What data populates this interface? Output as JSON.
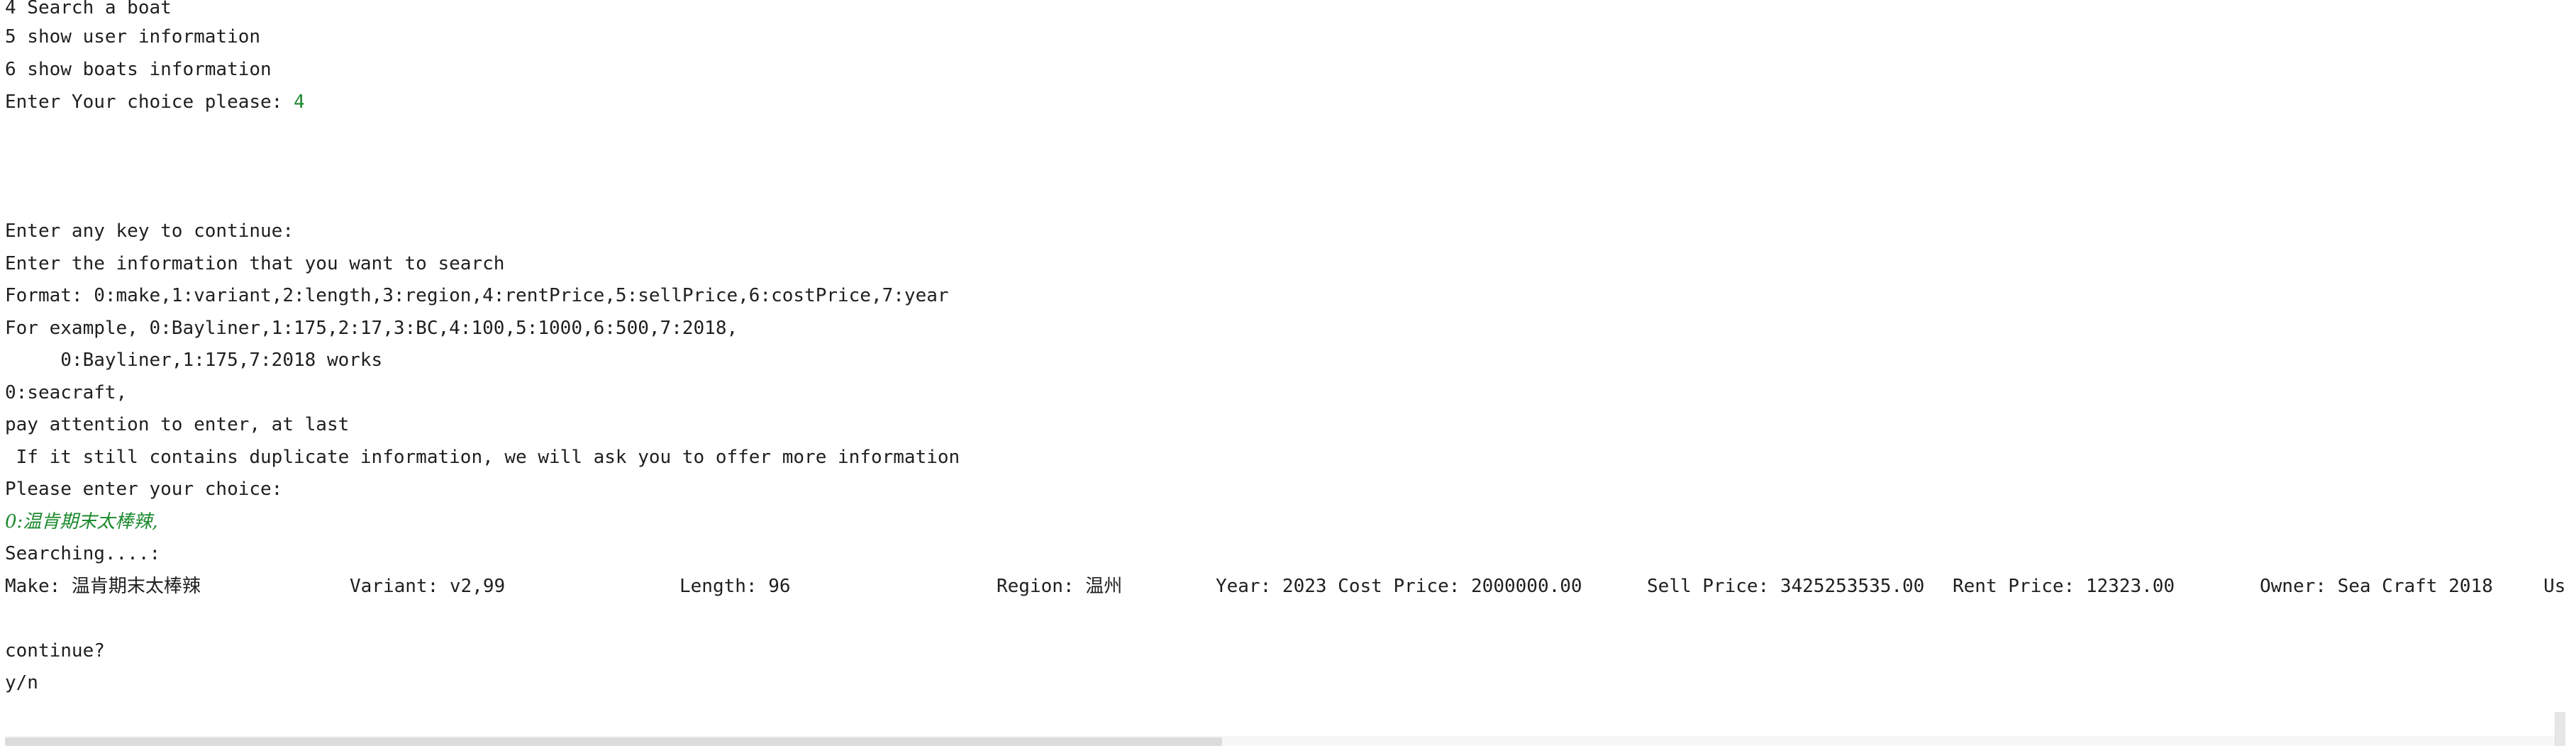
{
  "console": {
    "menu": [
      "4 Search a boat",
      "5 show user information",
      "6 show boats information"
    ],
    "choice_prompt": "Enter Your choice please: ",
    "choice_value": "4",
    "continue_prompt": "Enter any key to continue:",
    "search_intro": "Enter the information that you want to search",
    "format_line": "Format: 0:make,1:variant,2:length,3:region,4:rentPrice,5:sellPrice,6:costPrice,7:year",
    "example_line_1": "For example, 0:Bayliner,1:175,2:17,3:BC,4:100,5:1000,6:500,7:2018,",
    "example_line_2": "     0:Bayliner,1:175,7:2018 works",
    "echo_line": "0:seacraft,",
    "attention_line": "pay attention to enter, at last",
    "duplicate_line": " If it still contains duplicate information, we will ask you to offer more information",
    "enter_choice_prompt": "Please enter your choice:",
    "user_input": "0:温肯期末太棒辣,",
    "searching": "Searching....:",
    "result": {
      "make_label": "Make: ",
      "make_value": "温肯期末太棒辣",
      "variant": "Variant: v2,99",
      "length": "Length: 96",
      "region_label": "Region: ",
      "region_value": "温州",
      "year_cost": "Year: 2023 Cost Price: 2000000.00",
      "sell": "Sell Price: 3425253535.00",
      "rent": "Rent Price: 12323.00",
      "owner": "Owner: Sea Craft 2018",
      "overflow": "Us"
    },
    "continue_question": "continue?",
    "yn": "y/n"
  },
  "colors": {
    "text": "#1f1f1f",
    "user_input": "#1c8a2e",
    "background": "#ffffff"
  }
}
